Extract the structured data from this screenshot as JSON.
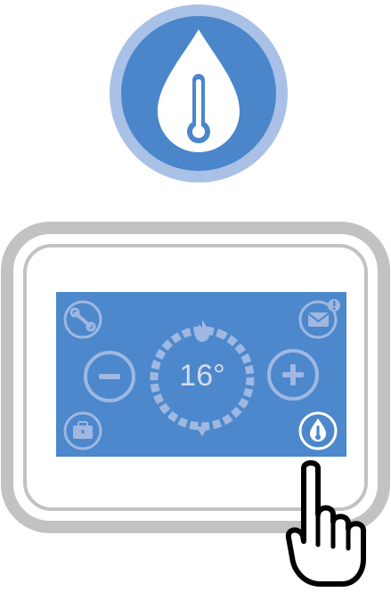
{
  "colors": {
    "badge_ring": "#a9c1e6",
    "badge_fill": "#4a86c9",
    "screen": "#4c88cb",
    "device_frame": "#c2c2c2",
    "control_tint": "#9fb8e2",
    "active_ring": "#ffffff"
  },
  "badge": {
    "icon": "water-drop-thermometer-icon"
  },
  "thermostat": {
    "temperature": "16°",
    "icons": {
      "settings": "wrench-icon",
      "messages": "envelope-icon",
      "notification": "alert-badge-icon",
      "decrease": "minus-icon",
      "increase": "plus-icon",
      "heating": "flame-icon",
      "schedule": "briefcase-icon",
      "hot_water": "water-drop-thermometer-icon",
      "pointer": "pointing-hand-icon"
    }
  }
}
